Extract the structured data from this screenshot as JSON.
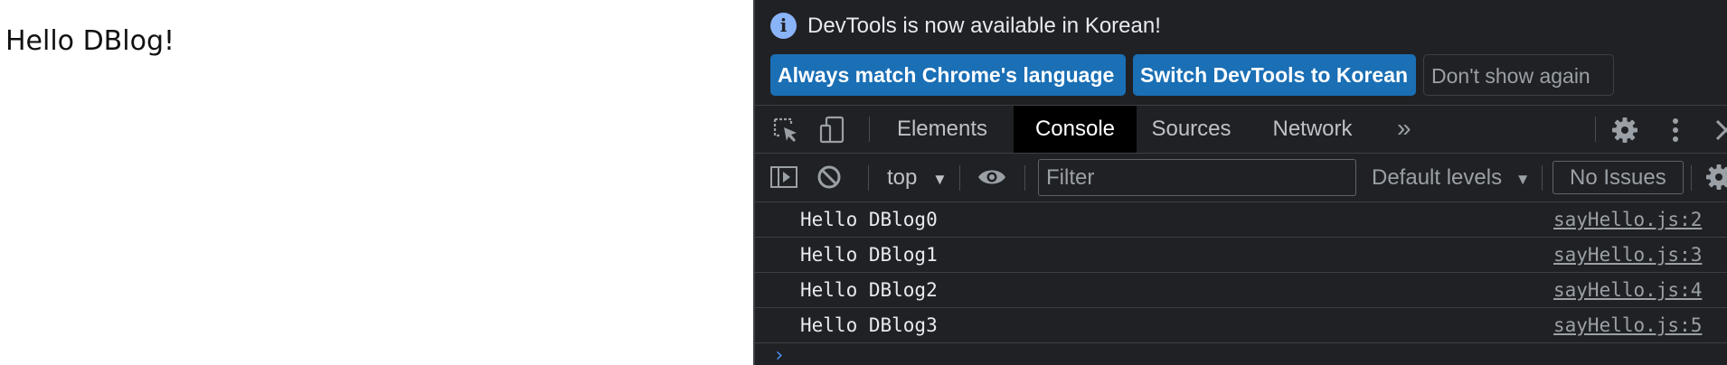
{
  "page": {
    "text": "Hello DBlog!"
  },
  "infobar": {
    "message": "DevTools is now available in Korean!",
    "buttons": {
      "always_match": "Always match Chrome's language",
      "switch": "Switch DevTools to Korean",
      "dont_show": "Don't show again"
    }
  },
  "tabs": [
    "Elements",
    "Console",
    "Sources",
    "Network"
  ],
  "active_tab": "Console",
  "more_tabs_glyph": "»",
  "console_toolbar": {
    "context": "top",
    "filter_placeholder": "Filter",
    "levels": "Default levels",
    "issues": "No Issues"
  },
  "logs": [
    {
      "message": "Hello DBlog0",
      "source": "sayHello.js:2"
    },
    {
      "message": "Hello DBlog1",
      "source": "sayHello.js:3"
    },
    {
      "message": "Hello DBlog2",
      "source": "sayHello.js:4"
    },
    {
      "message": "Hello DBlog3",
      "source": "sayHello.js:5"
    }
  ],
  "prompt_glyph": "›",
  "colors": {
    "devtools_bg": "#202124",
    "primary_button": "#1a6fb5",
    "info_icon": "#8ab4f8",
    "prompt": "#4a8ff0"
  }
}
